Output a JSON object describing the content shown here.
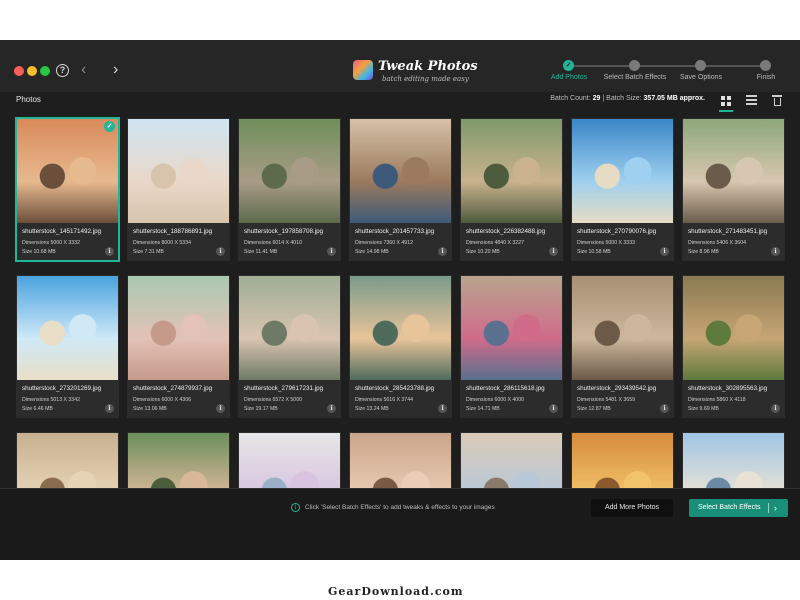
{
  "app": {
    "logo_title": "Tweak Photos",
    "logo_subtitle": "batch editing made easy"
  },
  "steps": [
    {
      "label": "Add Photos",
      "active": true
    },
    {
      "label": "Select Batch Effects",
      "active": false
    },
    {
      "label": "Save Options",
      "active": false
    },
    {
      "label": "Finish",
      "active": false
    }
  ],
  "header": {
    "section_title": "Photos",
    "batch_count_label": "Batch Count:",
    "batch_count": "29",
    "batch_separator": "|",
    "batch_size_label": "Batch Size:",
    "batch_size": "357.05 MB approx."
  },
  "photos": [
    {
      "name": "shutterstock_145171492.jpg",
      "dims": "Dimensions 5000 X 3332",
      "size": "Size 10.68 MB",
      "selected": true,
      "colors": [
        "#d98a5a",
        "#e7b98f",
        "#6b4f3a"
      ]
    },
    {
      "name": "shutterstock_188786891.jpg",
      "dims": "Dimensions 8000 X 5334",
      "size": "Size 7.31 MB",
      "selected": false,
      "colors": [
        "#cfe4f2",
        "#e9d8c9",
        "#d8c4ad"
      ]
    },
    {
      "name": "shutterstock_197858708.jpg",
      "dims": "Dimensions 6014 X 4010",
      "size": "Size 11.41 MB",
      "selected": false,
      "colors": [
        "#6f8f5a",
        "#a99c86",
        "#5d6b4b"
      ]
    },
    {
      "name": "shutterstock_201457733.jpg",
      "dims": "Dimensions 7360 X 4912",
      "size": "Size 14.98 MB",
      "selected": false,
      "colors": [
        "#d6c2a8",
        "#9b7a5d",
        "#3e5a7a"
      ]
    },
    {
      "name": "shutterstock_226382488.jpg",
      "dims": "Dimensions 4840 X 3227",
      "size": "Size 10.20 MB",
      "selected": false,
      "colors": [
        "#7f9a6a",
        "#c9b28d",
        "#4e5c3e"
      ]
    },
    {
      "name": "shutterstock_270790076.jpg",
      "dims": "Dimensions 5000 X 3333",
      "size": "Size 10.58 MB",
      "selected": false,
      "colors": [
        "#3a86c8",
        "#9fd0ef",
        "#e6dcc4"
      ]
    },
    {
      "name": "shutterstock_271483451.jpg",
      "dims": "Dimensions 5406 X 3604",
      "size": "Size 8.96 MB",
      "selected": false,
      "colors": [
        "#8ca77a",
        "#d8c7b0",
        "#6a5b4a"
      ]
    },
    {
      "name": "shutterstock_273201269.jpg",
      "dims": "Dimensions 5013 X 3342",
      "size": "Size 6.46 MB",
      "selected": false,
      "colors": [
        "#4aa3e0",
        "#cfe9f7",
        "#e9dfc8"
      ]
    },
    {
      "name": "shutterstock_274879937.jpg",
      "dims": "Dimensions 6000 X 4306",
      "size": "Size 13.06 MB",
      "selected": false,
      "colors": [
        "#a9c9b0",
        "#e3c2b7",
        "#c59a8a"
      ]
    },
    {
      "name": "shutterstock_279617231.jpg",
      "dims": "Dimensions 6572 X 5000",
      "size": "Size 19.17 MB",
      "selected": false,
      "colors": [
        "#9fae95",
        "#d9c4b1",
        "#6e7a66"
      ]
    },
    {
      "name": "shutterstock_285423788.jpg",
      "dims": "Dimensions 5616 X 3744",
      "size": "Size 13.24 MB",
      "selected": false,
      "colors": [
        "#7a9a8a",
        "#e8c49a",
        "#4f6b5c"
      ]
    },
    {
      "name": "shutterstock_286115618.jpg",
      "dims": "Dimensions 6000 X 4000",
      "size": "Size 14.71 MB",
      "selected": false,
      "colors": [
        "#b9a48e",
        "#d06b8a",
        "#5b6f8f"
      ]
    },
    {
      "name": "shutterstock_293439542.jpg",
      "dims": "Dimensions 5481 X 3659",
      "size": "Size 12.87 MB",
      "selected": false,
      "colors": [
        "#a89074",
        "#cdb79c",
        "#6b5a48"
      ]
    },
    {
      "name": "shutterstock_302895563.jpg",
      "dims": "Dimensions 5860 X 4118",
      "size": "Size 9.69 MB",
      "selected": false,
      "colors": [
        "#8a7a52",
        "#c7a574",
        "#5e7a3c"
      ]
    },
    {
      "name": "",
      "dims": "",
      "size": "",
      "selected": false,
      "colors": [
        "#c7b08f",
        "#e7d4b7",
        "#8a6d4e"
      ]
    },
    {
      "name": "",
      "dims": "",
      "size": "",
      "selected": false,
      "colors": [
        "#6b8f5a",
        "#d9b89a",
        "#4a5e3c"
      ]
    },
    {
      "name": "",
      "dims": "",
      "size": "",
      "selected": false,
      "colors": [
        "#e6e6e6",
        "#d8c4e0",
        "#9ab0c8"
      ]
    },
    {
      "name": "",
      "dims": "",
      "size": "",
      "selected": false,
      "colors": [
        "#c9a48a",
        "#e9cdb4",
        "#7a5a44"
      ]
    },
    {
      "name": "",
      "dims": "",
      "size": "",
      "selected": false,
      "colors": [
        "#d9cbb8",
        "#b8c8d8",
        "#8a7a6a"
      ]
    },
    {
      "name": "",
      "dims": "",
      "size": "",
      "selected": false,
      "colors": [
        "#d68a3c",
        "#f2c46a",
        "#8a5a2c"
      ]
    },
    {
      "name": "",
      "dims": "",
      "size": "",
      "selected": false,
      "colors": [
        "#9fc6e6",
        "#e9e2d4",
        "#6a8aa8"
      ]
    }
  ],
  "footer": {
    "hint": "Click 'Select Batch Effects' to add tweaks & effects to your images",
    "add_more_label": "Add More Photos",
    "select_effects_label": "Select Batch Effects"
  },
  "watermark": "GearDownload.com",
  "accent_color": "#21b59a"
}
